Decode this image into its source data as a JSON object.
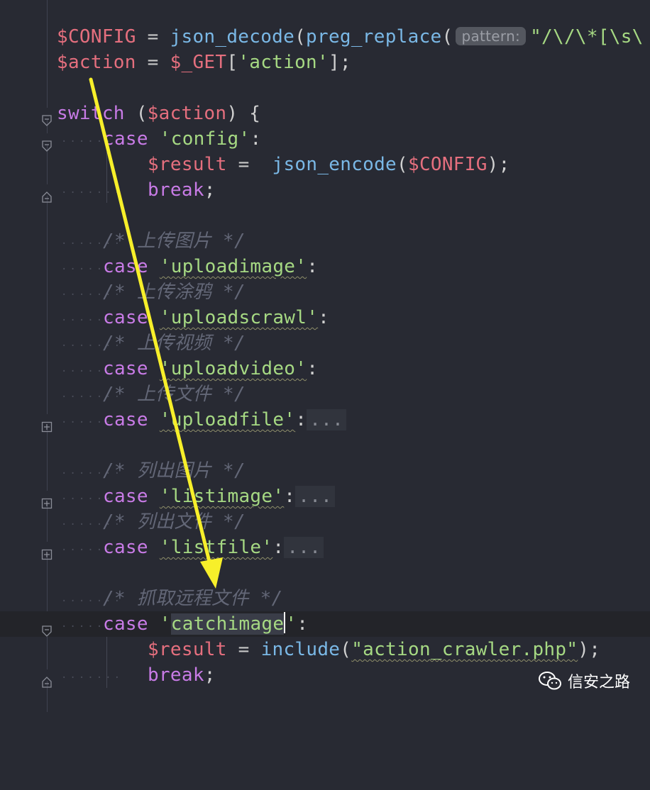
{
  "code": {
    "l1": {
      "var": "$CONFIG",
      "eq": " = ",
      "fn1": "json_decode",
      "p1": "(",
      "fn2": "preg_replace",
      "p2": "(",
      "hint": "pattern:",
      "str": "\"/\\/\\*[\\s\\"
    },
    "l2": {
      "var": "$action",
      "eq": " = ",
      "get": "$_GET",
      "b1": "[",
      "str": "'action'",
      "b2": "];"
    },
    "l3": {
      "kw": "switch",
      "p1": " (",
      "var": "$action",
      "p2": ") {"
    },
    "l4": {
      "kw": "case",
      "sp": " ",
      "str": "'config'",
      "colon": ":"
    },
    "l5": {
      "var": "$result",
      "eq": " =  ",
      "fn": "json_encode",
      "p1": "(",
      "arg": "$CONFIG",
      "p2": ");"
    },
    "l6": {
      "kw": "break",
      "semi": ";"
    },
    "c1": "/* 上传图片 */",
    "l7": {
      "kw": "case",
      "sp": " ",
      "str": "'uploadimage'",
      "colon": ":"
    },
    "c2": "/* 上传涂鸦 */",
    "l8": {
      "kw": "case",
      "sp": " ",
      "str": "'uploadscrawl'",
      "colon": ":"
    },
    "c3": "/* 上传视频 */",
    "l9": {
      "kw": "case",
      "sp": " ",
      "str": "'uploadvideo'",
      "colon": ":"
    },
    "c4": "/* 上传文件 */",
    "l10": {
      "kw": "case",
      "sp": " ",
      "str": "'uploadfile'",
      "colon": ":",
      "more": "..."
    },
    "c5": "/* 列出图片 */",
    "l11": {
      "kw": "case",
      "sp": " ",
      "str": "'listimage'",
      "colon": ":",
      "more": "..."
    },
    "c6": "/* 列出文件 */",
    "l12": {
      "kw": "case",
      "sp": " ",
      "str": "'listfile'",
      "colon": ":",
      "more": "..."
    },
    "c7": "/* 抓取远程文件 */",
    "l13": {
      "kw": "case",
      "sp": " ",
      "q1": "'",
      "sel": "catchimage",
      "q2": "'",
      "colon": ":"
    },
    "l14": {
      "var": "$result",
      "eq": " = ",
      "fn": "include",
      "p1": "(",
      "str": "\"action_crawler.php\"",
      "p2": ");"
    },
    "l15": {
      "kw": "break",
      "semi": ";"
    }
  },
  "watermark": {
    "text": "信安之路",
    "icon": "wechat-icon"
  },
  "colors": {
    "background": "#282a33",
    "arrow": "#f7ef2a",
    "keyword": "#c87be6",
    "variable": "#e56f7e",
    "string": "#a6d983",
    "function": "#7ab8e6",
    "comment": "#636777"
  }
}
